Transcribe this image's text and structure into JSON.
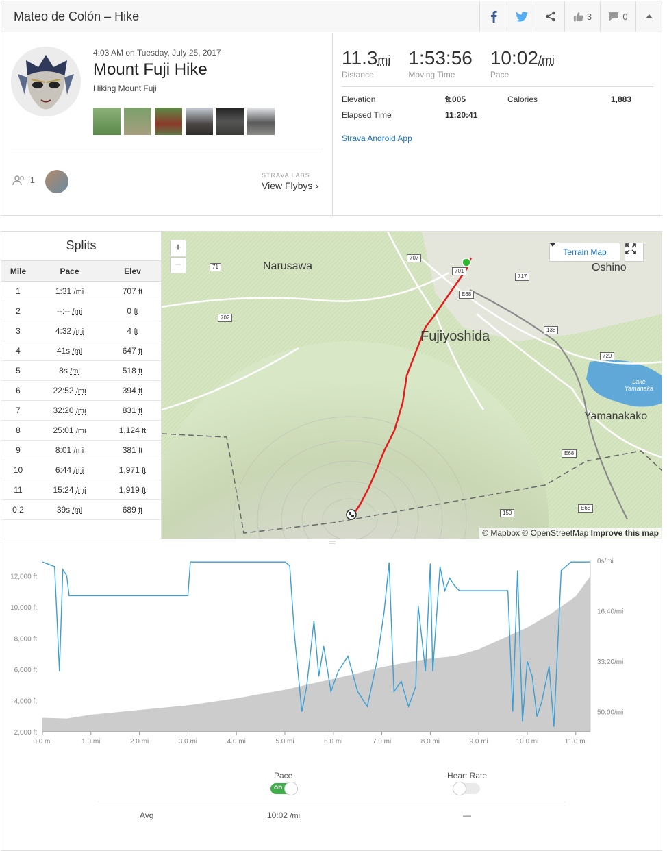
{
  "header": {
    "title": "Mateo de Colón – Hike",
    "kudos": "3",
    "comments": "0"
  },
  "activity": {
    "datetime": "4:03 AM on Tuesday, July 25, 2017",
    "name": "Mount Fuji Hike",
    "description": "Hiking Mount Fuji",
    "kudos_count": "1",
    "flyby_label": "STRAVA LABS",
    "flyby_link": "View Flybys ›"
  },
  "stats": {
    "distance": "11.3",
    "distance_unit": "mi",
    "distance_label": "Distance",
    "moving_time": "1:53:56",
    "moving_time_label": "Moving Time",
    "pace": "10:02",
    "pace_unit": "/mi",
    "pace_label": "Pace",
    "elevation_label": "Elevation",
    "elevation": "9,005",
    "elevation_unit": "ft",
    "calories_label": "Calories",
    "calories": "1,883",
    "elapsed_label": "Elapsed Time",
    "elapsed": "11:20:41",
    "app": "Strava Android App"
  },
  "splits": {
    "title": "Splits",
    "columns": [
      "Mile",
      "Pace",
      "Elev"
    ],
    "rows": [
      {
        "mile": "1",
        "pace": "1:31",
        "elev": "707"
      },
      {
        "mile": "2",
        "pace": "--:--",
        "elev": "0"
      },
      {
        "mile": "3",
        "pace": "4:32",
        "elev": "4"
      },
      {
        "mile": "4",
        "pace": "41s",
        "elev": "647"
      },
      {
        "mile": "5",
        "pace": "8s",
        "elev": "518"
      },
      {
        "mile": "6",
        "pace": "22:52",
        "elev": "394"
      },
      {
        "mile": "7",
        "pace": "32:20",
        "elev": "831"
      },
      {
        "mile": "8",
        "pace": "25:01",
        "elev": "1,124"
      },
      {
        "mile": "9",
        "pace": "8:01",
        "elev": "381"
      },
      {
        "mile": "10",
        "pace": "6:44",
        "elev": "1,971"
      },
      {
        "mile": "11",
        "pace": "15:24",
        "elev": "1,919"
      },
      {
        "mile": "0.2",
        "pace": "39s",
        "elev": "689"
      }
    ],
    "pace_unit": "/mi",
    "elev_unit": "ft"
  },
  "map": {
    "zoom_in": "+",
    "zoom_out": "−",
    "terrain_button": "Terrain Map",
    "places": [
      "Narusawa",
      "Fujiyoshida",
      "Oshino",
      "Yamanakako",
      "Lake Yamanaka"
    ],
    "roads": [
      "71",
      "707",
      "701",
      "717",
      "E68",
      "702",
      "138",
      "729",
      "E68",
      "E68",
      "150"
    ],
    "attribution_mapbox": "© Mapbox",
    "attribution_osm": "© OpenStreetMap",
    "attribution_improve": "Improve this map",
    "route_color": "#e31b1b"
  },
  "chart_data": {
    "type": "area",
    "x_ticks": [
      "0.0 mi",
      "1.0 mi",
      "2.0 mi",
      "3.0 mi",
      "4.0 mi",
      "5.0 mi",
      "6.0 mi",
      "7.0 mi",
      "8.0 mi",
      "9.0 mi",
      "10.0 mi",
      "11.0 mi"
    ],
    "y_left_ticks": [
      "12,000 ft",
      "10,000 ft",
      "8,000 ft",
      "6,000 ft",
      "4,000 ft",
      "2,000 ft"
    ],
    "y_right_ticks": [
      "0s/mi",
      "16:40/mi",
      "33:20/mi",
      "50:00/mi"
    ],
    "xlim": [
      0,
      11.3
    ],
    "elev_ylim": [
      2000,
      13000
    ],
    "pace_ylim_sec": [
      0,
      3400
    ],
    "series": [
      {
        "name": "Elevation",
        "color": "#cccccc",
        "x": [
          0.0,
          0.5,
          1.0,
          2.0,
          3.0,
          4.0,
          5.0,
          5.5,
          6.0,
          6.5,
          7.0,
          7.5,
          8.0,
          8.5,
          9.0,
          9.5,
          10.0,
          10.5,
          11.0,
          11.3
        ],
        "values": [
          2900,
          2850,
          3100,
          3400,
          3700,
          4150,
          4700,
          5050,
          5400,
          5750,
          6150,
          6450,
          6700,
          6850,
          7300,
          8000,
          8700,
          9600,
          10700,
          12000
        ]
      },
      {
        "name": "Pace",
        "color": "#3a9fd6",
        "x": [
          0.0,
          0.25,
          0.35,
          0.42,
          0.5,
          0.55,
          1.0,
          2.0,
          3.0,
          3.05,
          5.0,
          5.1,
          5.2,
          5.35,
          5.45,
          5.6,
          5.7,
          5.8,
          5.95,
          6.1,
          6.3,
          6.5,
          6.7,
          6.9,
          7.05,
          7.15,
          7.25,
          7.4,
          7.55,
          7.7,
          7.75,
          7.9,
          8.0,
          8.05,
          8.2,
          8.3,
          8.4,
          8.5,
          8.6,
          9.0,
          9.6,
          9.7,
          9.8,
          9.9,
          10.0,
          10.1,
          10.2,
          10.3,
          10.45,
          10.55,
          10.7,
          10.9,
          11.3
        ],
        "values": [
          30,
          120,
          2200,
          180,
          300,
          700,
          700,
          700,
          700,
          30,
          30,
          100,
          1500,
          3000,
          2500,
          1200,
          2300,
          1700,
          2600,
          2200,
          1900,
          2600,
          2900,
          2000,
          1000,
          40,
          2600,
          2400,
          2900,
          2500,
          900,
          2200,
          60,
          2200,
          120,
          600,
          350,
          500,
          600,
          600,
          600,
          3000,
          200,
          3200,
          2000,
          2300,
          3100,
          2800,
          2100,
          3300,
          200,
          30,
          30
        ]
      }
    ]
  },
  "controls": {
    "pace_label": "Pace",
    "pace_toggle": "on",
    "hr_label": "Heart Rate",
    "avg_label": "Avg",
    "avg_pace": "10:02",
    "avg_pace_unit": "/mi",
    "avg_hr": "—"
  }
}
